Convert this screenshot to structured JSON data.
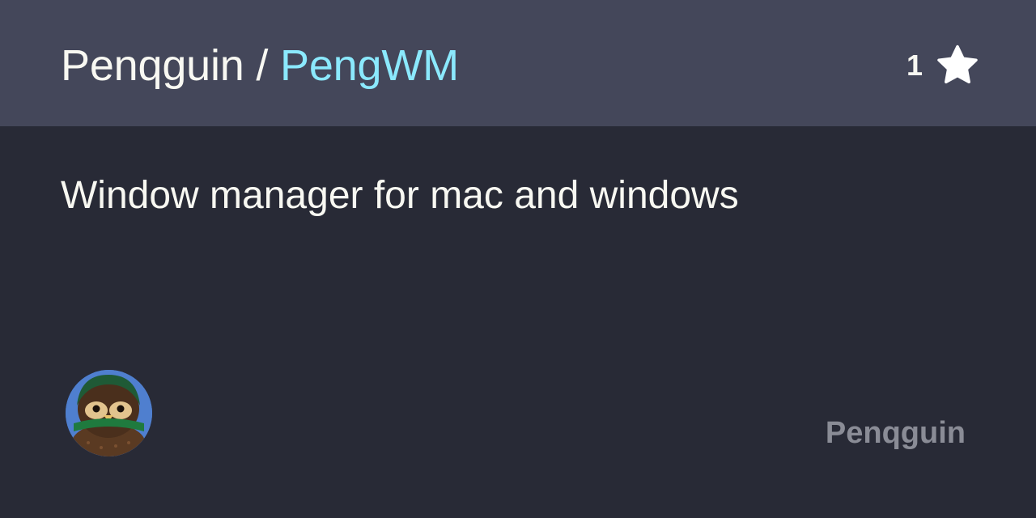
{
  "header": {
    "owner": "Penqguin",
    "separator": " / ",
    "repo": "PengWM",
    "star_count": "1",
    "star_icon": "star-icon"
  },
  "description": "Window manager for mac and windows",
  "footer": {
    "owner_name": "Penqguin",
    "avatar_icon": "crochet-penguin-avatar"
  },
  "colors": {
    "header_bg": "#44475a",
    "body_bg": "#282a36",
    "repo_name": "#8be9fd",
    "text": "#f8f8f2",
    "muted": "#8a8c96"
  }
}
